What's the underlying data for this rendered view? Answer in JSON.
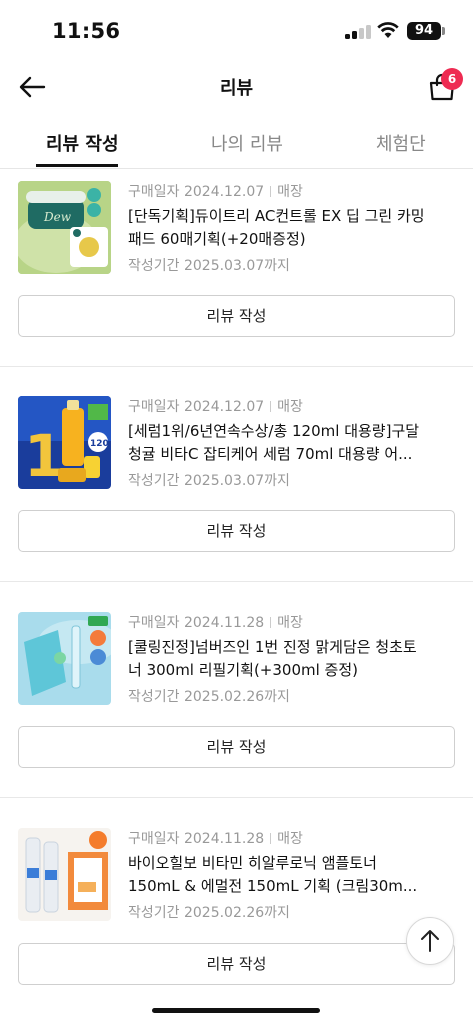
{
  "status": {
    "time": "11:56",
    "battery": "94"
  },
  "header": {
    "title": "리뷰",
    "cart_count": "6"
  },
  "tabs": [
    {
      "label": "리뷰 작성",
      "active": true
    },
    {
      "label": "나의 리뷰",
      "active": false
    },
    {
      "label": "체험단",
      "active": false
    }
  ],
  "items": [
    {
      "purchase_label": "구매일자 2024.12.07",
      "channel": "매장",
      "name": "[단독기획]듀이트리 AC컨트롤 EX 딥 그린 카밍 패드 60매기획(+20매증정)",
      "deadline": "작성기간 2025.03.07까지",
      "button_label": "리뷰 작성"
    },
    {
      "purchase_label": "구매일자 2024.12.07",
      "channel": "매장",
      "name": "[세럼1위/6년연속수상/총 120ml 대용량]구달 청귤 비타C 잡티케어 세럼 70ml 대용량 어...",
      "deadline": "작성기간 2025.03.07까지",
      "button_label": "리뷰 작성"
    },
    {
      "purchase_label": "구매일자 2024.11.28",
      "channel": "매장",
      "name": "[쿨링진정]넘버즈인 1번 진정 맑게담은 청초토너 300ml 리필기획(+300ml 증정)",
      "deadline": "작성기간 2025.02.26까지",
      "button_label": "리뷰 작성"
    },
    {
      "purchase_label": "구매일자 2024.11.28",
      "channel": "매장",
      "name": "바이오힐보 비타민 히알루로닉 앰플토너 150mL & 에멀전 150mL 기획 (크림30m...",
      "deadline": "작성기간 2025.02.26까지",
      "button_label": "리뷰 작성"
    }
  ],
  "icons": {
    "back": "arrow-left-icon",
    "cart": "shopping-bag-icon",
    "scroll_top": "arrow-up-icon"
  },
  "colors": {
    "accent": "#ee2b52",
    "text": "#111111",
    "muted": "#999999"
  }
}
